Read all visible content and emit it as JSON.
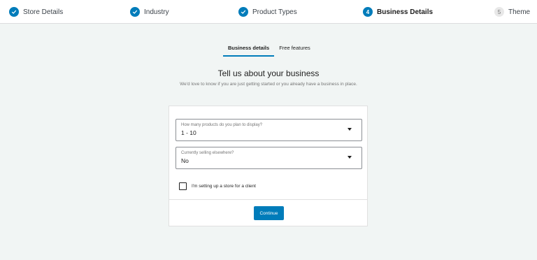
{
  "stepper": {
    "steps": [
      {
        "label": "Store Details",
        "status": "done",
        "icon": "check-icon"
      },
      {
        "label": "Industry",
        "status": "done",
        "icon": "check-icon"
      },
      {
        "label": "Product Types",
        "status": "done",
        "icon": "check-icon"
      },
      {
        "label": "Business Details",
        "status": "current",
        "number": "4"
      },
      {
        "label": "Theme",
        "status": "future",
        "number": "5"
      }
    ]
  },
  "tabs": [
    {
      "label": "Business details",
      "active": true
    },
    {
      "label": "Free features",
      "active": false
    }
  ],
  "header": {
    "title": "Tell us about your business",
    "subtitle": "We'd love to know if you are just getting started or you already have a business in place."
  },
  "form": {
    "products_field": {
      "label": "How many products do you plan to display?",
      "value": "1 - 10"
    },
    "selling_field": {
      "label": "Currently selling elsewhere?",
      "value": "No"
    },
    "client_checkbox": {
      "label": "I'm setting up a store for a client",
      "checked": false
    },
    "continue_label": "Continue"
  },
  "colors": {
    "accent": "#007cba",
    "background": "#f1f5f4"
  }
}
